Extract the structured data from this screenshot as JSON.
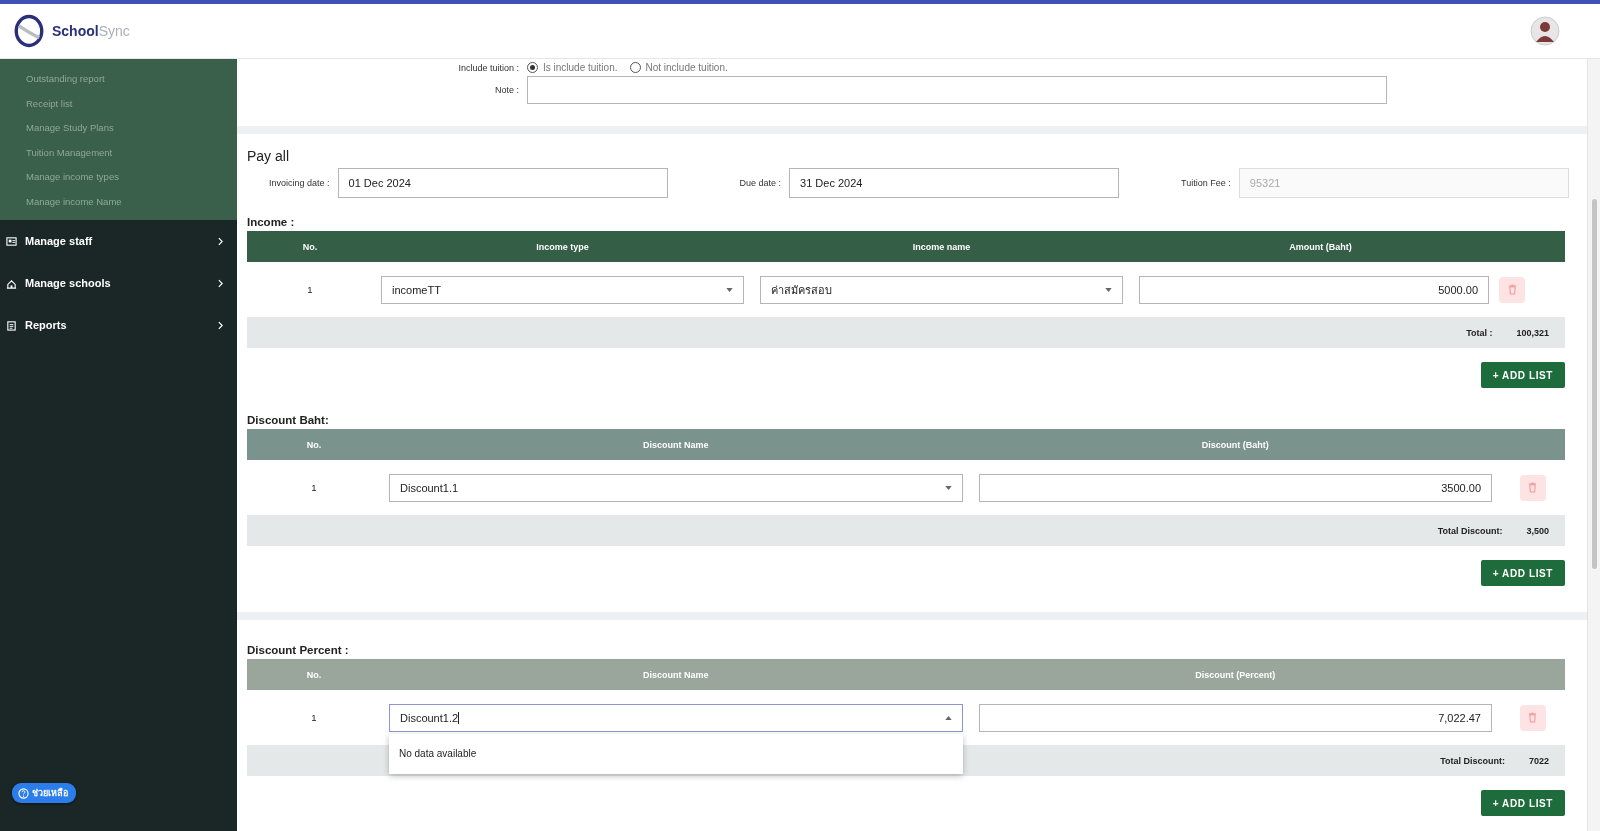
{
  "header": {
    "logo_primary": "School",
    "logo_secondary": "Sync"
  },
  "sidebar": {
    "sub_items": [
      {
        "label": "Outstanding report"
      },
      {
        "label": "Receipt list"
      },
      {
        "label": "Manage Study Plans"
      },
      {
        "label": "Tuition Management"
      },
      {
        "label": "Manage income types"
      },
      {
        "label": "Manage income Name"
      }
    ],
    "items": [
      {
        "label": "Manage staff"
      },
      {
        "label": "Manage schools"
      },
      {
        "label": "Reports"
      }
    ]
  },
  "help_button": {
    "label": "ช่วยเหลือ"
  },
  "general": {
    "include_tuition": {
      "label": "Include tuition :",
      "options": [
        {
          "label": "Is include tuition.",
          "selected": true
        },
        {
          "label": "Not include tuition.",
          "selected": false
        }
      ]
    },
    "note": {
      "label": "Note :"
    }
  },
  "pay_all": {
    "title": "Pay all",
    "fields": [
      {
        "label": "Invoicing date :",
        "value": "01 Dec 2024",
        "disabled": false
      },
      {
        "label": "Due date :",
        "value": "31 Dec 2024",
        "disabled": false
      },
      {
        "label": "Tuition Fee :",
        "value": "95321",
        "disabled": true
      }
    ]
  },
  "sections": [
    {
      "kind": "income",
      "title": "Income :",
      "color": "#355e47",
      "columns": [
        "No.",
        "Income type",
        "Income name",
        "Amount (Baht)"
      ],
      "rows": [
        {
          "no": "1",
          "selects": [
            {
              "value": "incomeTT",
              "open": false
            },
            {
              "value": "ค่าสมัครสอบ",
              "open": false
            }
          ],
          "amount": "5000.00"
        }
      ],
      "total_label": "Total :",
      "total": "100,321",
      "add_button": "+ ADD LIST"
    },
    {
      "kind": "discount",
      "title": "Discount Baht:",
      "color": "#7a938c",
      "columns": [
        "No.",
        "Discount Name",
        "Discount (Baht)"
      ],
      "rows": [
        {
          "no": "1",
          "selects": [
            {
              "value": "Discount1.1",
              "open": false
            }
          ],
          "amount": "3500.00"
        }
      ],
      "total_label": "Total Discount:",
      "total": "3,500",
      "add_button": "+ ADD LIST"
    },
    {
      "kind": "discount",
      "title": "Discount Percent :",
      "color": "#9aa59b",
      "columns": [
        "No.",
        "Discount Name",
        "Discount (Percent)"
      ],
      "rows": [
        {
          "no": "1",
          "selects": [
            {
              "value": "Discount1.2",
              "open": true,
              "menu_text": "No data available"
            }
          ],
          "amount": "7,022.47"
        }
      ],
      "total_label": "Total Discount:",
      "total": "7022",
      "add_button": "+ ADD LIST"
    }
  ]
}
